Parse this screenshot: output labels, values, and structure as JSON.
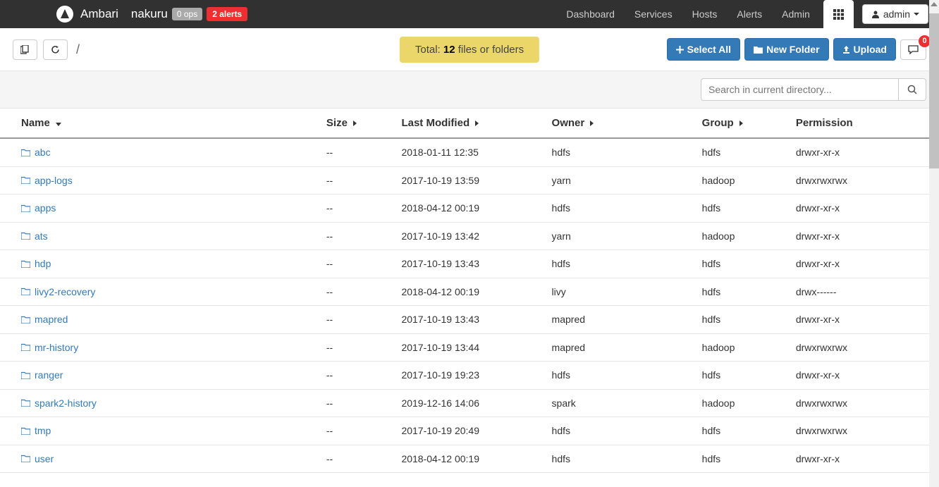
{
  "navbar": {
    "brand": "Ambari",
    "cluster": "nakuru",
    "ops_badge": "0 ops",
    "alerts_badge": "2 alerts",
    "links": [
      "Dashboard",
      "Services",
      "Hosts",
      "Alerts",
      "Admin"
    ],
    "user_label": "admin"
  },
  "toolbar": {
    "breadcrumb": "/",
    "total_prefix": "Total: ",
    "total_count": "12",
    "total_suffix": " files or folders",
    "select_all": "Select All",
    "new_folder": "New Folder",
    "upload": "Upload",
    "msg_count": "0"
  },
  "search": {
    "placeholder": "Search in current directory..."
  },
  "columns": {
    "name": "Name",
    "size": "Size",
    "modified": "Last Modified",
    "owner": "Owner",
    "group": "Group",
    "permission": "Permission"
  },
  "rows": [
    {
      "name": "abc",
      "size": "--",
      "modified": "2018-01-11 12:35",
      "owner": "hdfs",
      "group": "hdfs",
      "perm": "drwxr-xr-x"
    },
    {
      "name": "app-logs",
      "size": "--",
      "modified": "2017-10-19 13:59",
      "owner": "yarn",
      "group": "hadoop",
      "perm": "drwxrwxrwx"
    },
    {
      "name": "apps",
      "size": "--",
      "modified": "2018-04-12 00:19",
      "owner": "hdfs",
      "group": "hdfs",
      "perm": "drwxr-xr-x"
    },
    {
      "name": "ats",
      "size": "--",
      "modified": "2017-10-19 13:42",
      "owner": "yarn",
      "group": "hadoop",
      "perm": "drwxr-xr-x"
    },
    {
      "name": "hdp",
      "size": "--",
      "modified": "2017-10-19 13:43",
      "owner": "hdfs",
      "group": "hdfs",
      "perm": "drwxr-xr-x"
    },
    {
      "name": "livy2-recovery",
      "size": "--",
      "modified": "2018-04-12 00:19",
      "owner": "livy",
      "group": "hdfs",
      "perm": "drwx------"
    },
    {
      "name": "mapred",
      "size": "--",
      "modified": "2017-10-19 13:43",
      "owner": "mapred",
      "group": "hdfs",
      "perm": "drwxr-xr-x"
    },
    {
      "name": "mr-history",
      "size": "--",
      "modified": "2017-10-19 13:44",
      "owner": "mapred",
      "group": "hadoop",
      "perm": "drwxrwxrwx"
    },
    {
      "name": "ranger",
      "size": "--",
      "modified": "2017-10-19 19:23",
      "owner": "hdfs",
      "group": "hdfs",
      "perm": "drwxr-xr-x"
    },
    {
      "name": "spark2-history",
      "size": "--",
      "modified": "2019-12-16 14:06",
      "owner": "spark",
      "group": "hadoop",
      "perm": "drwxrwxrwx"
    },
    {
      "name": "tmp",
      "size": "--",
      "modified": "2017-10-19 20:49",
      "owner": "hdfs",
      "group": "hdfs",
      "perm": "drwxrwxrwx"
    },
    {
      "name": "user",
      "size": "--",
      "modified": "2018-04-12 00:19",
      "owner": "hdfs",
      "group": "hdfs",
      "perm": "drwxr-xr-x"
    }
  ]
}
